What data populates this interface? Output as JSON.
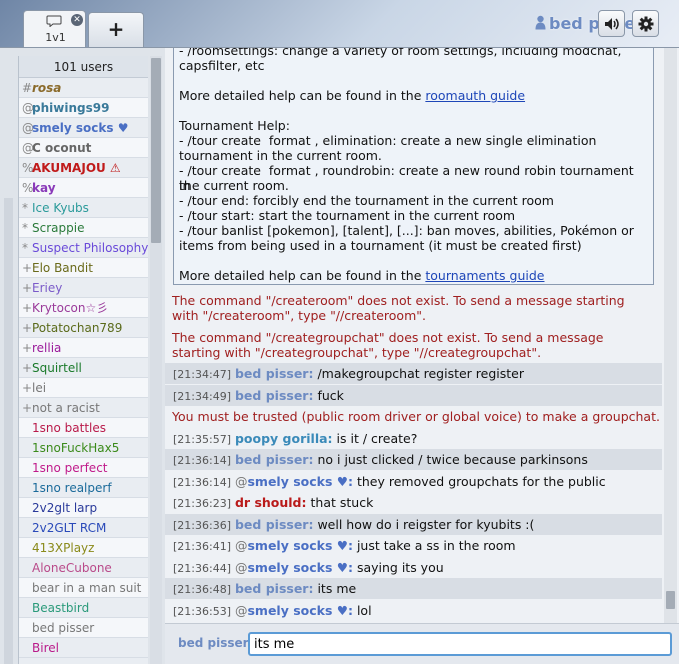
{
  "tabs": [
    {
      "label": "1v1",
      "close": "✕"
    }
  ],
  "add_tab_label": "+",
  "header": {
    "username": "bed pisser"
  },
  "userlist": {
    "count": "101 users",
    "users": [
      {
        "rank": "#",
        "name": "rosa",
        "color": "#8a6a2a",
        "bold": true,
        "italic": true
      },
      {
        "rank": "@",
        "name": "phiwings99",
        "color": "#3a7a9a",
        "bold": true
      },
      {
        "rank": "@",
        "name": "smely socks ♥",
        "color": "#4a6fc4",
        "bold": true
      },
      {
        "rank": "@",
        "name": "C oconut",
        "color": "#666666",
        "bold": true
      },
      {
        "rank": "%",
        "name": "AKUMAJOU ⚠",
        "color": "#c01a1a",
        "bold": true
      },
      {
        "rank": "%",
        "name": "kay",
        "color": "#8a3ab9",
        "bold": true
      },
      {
        "rank": "*",
        "name": "Ice Kyubs",
        "color": "#2a9a9a"
      },
      {
        "rank": "*",
        "name": "Scrappie",
        "color": "#2a7a3a"
      },
      {
        "rank": "*",
        "name": "Suspect Philosophy",
        "color": "#6a4ad9"
      },
      {
        "rank": "+",
        "name": "Elo Bandit",
        "color": "#6a6a1a"
      },
      {
        "rank": "+",
        "name": "Eriey",
        "color": "#7a5ac9"
      },
      {
        "rank": "+",
        "name": "Krytocon☆彡",
        "color": "#9a3a9a"
      },
      {
        "rank": "+",
        "name": "Potatochan789",
        "color": "#5a6a1a"
      },
      {
        "rank": "+",
        "name": "rellia",
        "color": "#9a1a9a"
      },
      {
        "rank": "+",
        "name": "Squirtell",
        "color": "#1a7a2a"
      },
      {
        "rank": "+",
        "name": "lei",
        "color": "#777777"
      },
      {
        "rank": "+",
        "name": "not a racist",
        "color": "#777777"
      },
      {
        "rank": "",
        "name": "1sno battles",
        "color": "#b91a4a"
      },
      {
        "rank": "",
        "name": "1snoFuckHax5",
        "color": "#3a8a1a"
      },
      {
        "rank": "",
        "name": "1sno perfect",
        "color": "#c01a8a"
      },
      {
        "rank": "",
        "name": "1sno realperf",
        "color": "#1a6a9a"
      },
      {
        "rank": "",
        "name": "2v2glt larp",
        "color": "#2a3a9a"
      },
      {
        "rank": "",
        "name": "2v2GLT RCM",
        "color": "#2a4ab9"
      },
      {
        "rank": "",
        "name": "413XPlayz",
        "color": "#8a8a1a"
      },
      {
        "rank": "",
        "name": "AloneCubone",
        "color": "#b94a8a"
      },
      {
        "rank": "",
        "name": "bear in a man suit",
        "color": "#777777"
      },
      {
        "rank": "",
        "name": "Beastbird",
        "color": "#2a9a7a"
      },
      {
        "rank": "",
        "name": "bed pisser",
        "color": "#777777"
      },
      {
        "rank": "",
        "name": "Birel",
        "color": "#b91a8a"
      }
    ]
  },
  "help": {
    "lines": [
      {
        "text": "- /roomsettings: change a variety of room settings, including modchat,"
      },
      {
        "text": "capsfilter, etc"
      },
      {
        "text": ""
      },
      {
        "text": "More detailed help can be found in the ",
        "link": "roomauth guide"
      },
      {
        "text": ""
      },
      {
        "text": "Tournament Help:"
      },
      {
        "text": "- /tour create  format , elimination: create a new single elimination"
      },
      {
        "text": "tournament in the current room."
      },
      {
        "text": "- /tour create  format , roundrobin: create a new round robin tournament in"
      },
      {
        "text": "the current room."
      },
      {
        "text": "- /tour end: forcibly end the tournament in the current room"
      },
      {
        "text": "- /tour start: start the tournament in the current room"
      },
      {
        "text": "- /tour banlist [pokemon], [talent], [...]: ban moves, abilities, Pokémon or"
      },
      {
        "text": "items from being used in a tournament (it must be created first)"
      },
      {
        "text": ""
      },
      {
        "text": "More detailed help can be found in the ",
        "link": "tournaments guide"
      }
    ]
  },
  "errors": [
    {
      "text": "The command \"/createroom\" does not exist. To send a message starting with \"/createroom\", type \"//createroom\"."
    },
    {
      "text": "The command \"/creategroupchat\" does not exist. To send a message starting with \"/creategroupchat\", type \"//creategroupchat\"."
    }
  ],
  "messages": [
    {
      "time": "[21:34:47]",
      "rank": "",
      "sender": "bed pisser:",
      "color": "#6d8bc2",
      "text": "/makegroupchat register register",
      "hl": true
    },
    {
      "time": "[21:34:49]",
      "rank": "",
      "sender": "bed pisser:",
      "color": "#6d8bc2",
      "text": "fuck",
      "hl": true
    },
    {
      "system": "You must be trusted (public room driver or global voice) to make a groupchat."
    },
    {
      "time": "[21:35:57]",
      "rank": "",
      "sender": "poopy gorilla:",
      "color": "#3a8ab9",
      "text": "is it / create?",
      "hl": false
    },
    {
      "time": "[21:36:14]",
      "rank": "",
      "sender": "bed pisser:",
      "color": "#6d8bc2",
      "text": "no i just clicked / twice because parkinsons",
      "hl": true
    },
    {
      "time": "[21:36:14]",
      "rank": "@",
      "sender": "smely socks ♥:",
      "color": "#4a6fc4",
      "text": "they removed groupchats for the public",
      "hl": false
    },
    {
      "time": "[21:36:23]",
      "rank": "",
      "sender": "dr should:",
      "color": "#b91a1a",
      "text": "that stuck",
      "hl": false
    },
    {
      "time": "[21:36:36]",
      "rank": "",
      "sender": "bed pisser:",
      "color": "#6d8bc2",
      "text": "well how do i reigster for kyubits :(",
      "hl": true
    },
    {
      "time": "[21:36:41]",
      "rank": "@",
      "sender": "smely socks ♥:",
      "color": "#4a6fc4",
      "text": "just take a ss in the room",
      "hl": false
    },
    {
      "time": "[21:36:44]",
      "rank": "@",
      "sender": "smely socks ♥:",
      "color": "#4a6fc4",
      "text": "saying its you",
      "hl": false
    },
    {
      "time": "[21:36:48]",
      "rank": "",
      "sender": "bed pisser:",
      "color": "#6d8bc2",
      "text": "its me",
      "hl": true
    },
    {
      "time": "[21:36:53]",
      "rank": "@",
      "sender": "smely socks ♥:",
      "color": "#4a6fc4",
      "text": "lol",
      "hl": false
    }
  ],
  "compose": {
    "name": "bed pisser:",
    "value": "its me"
  }
}
